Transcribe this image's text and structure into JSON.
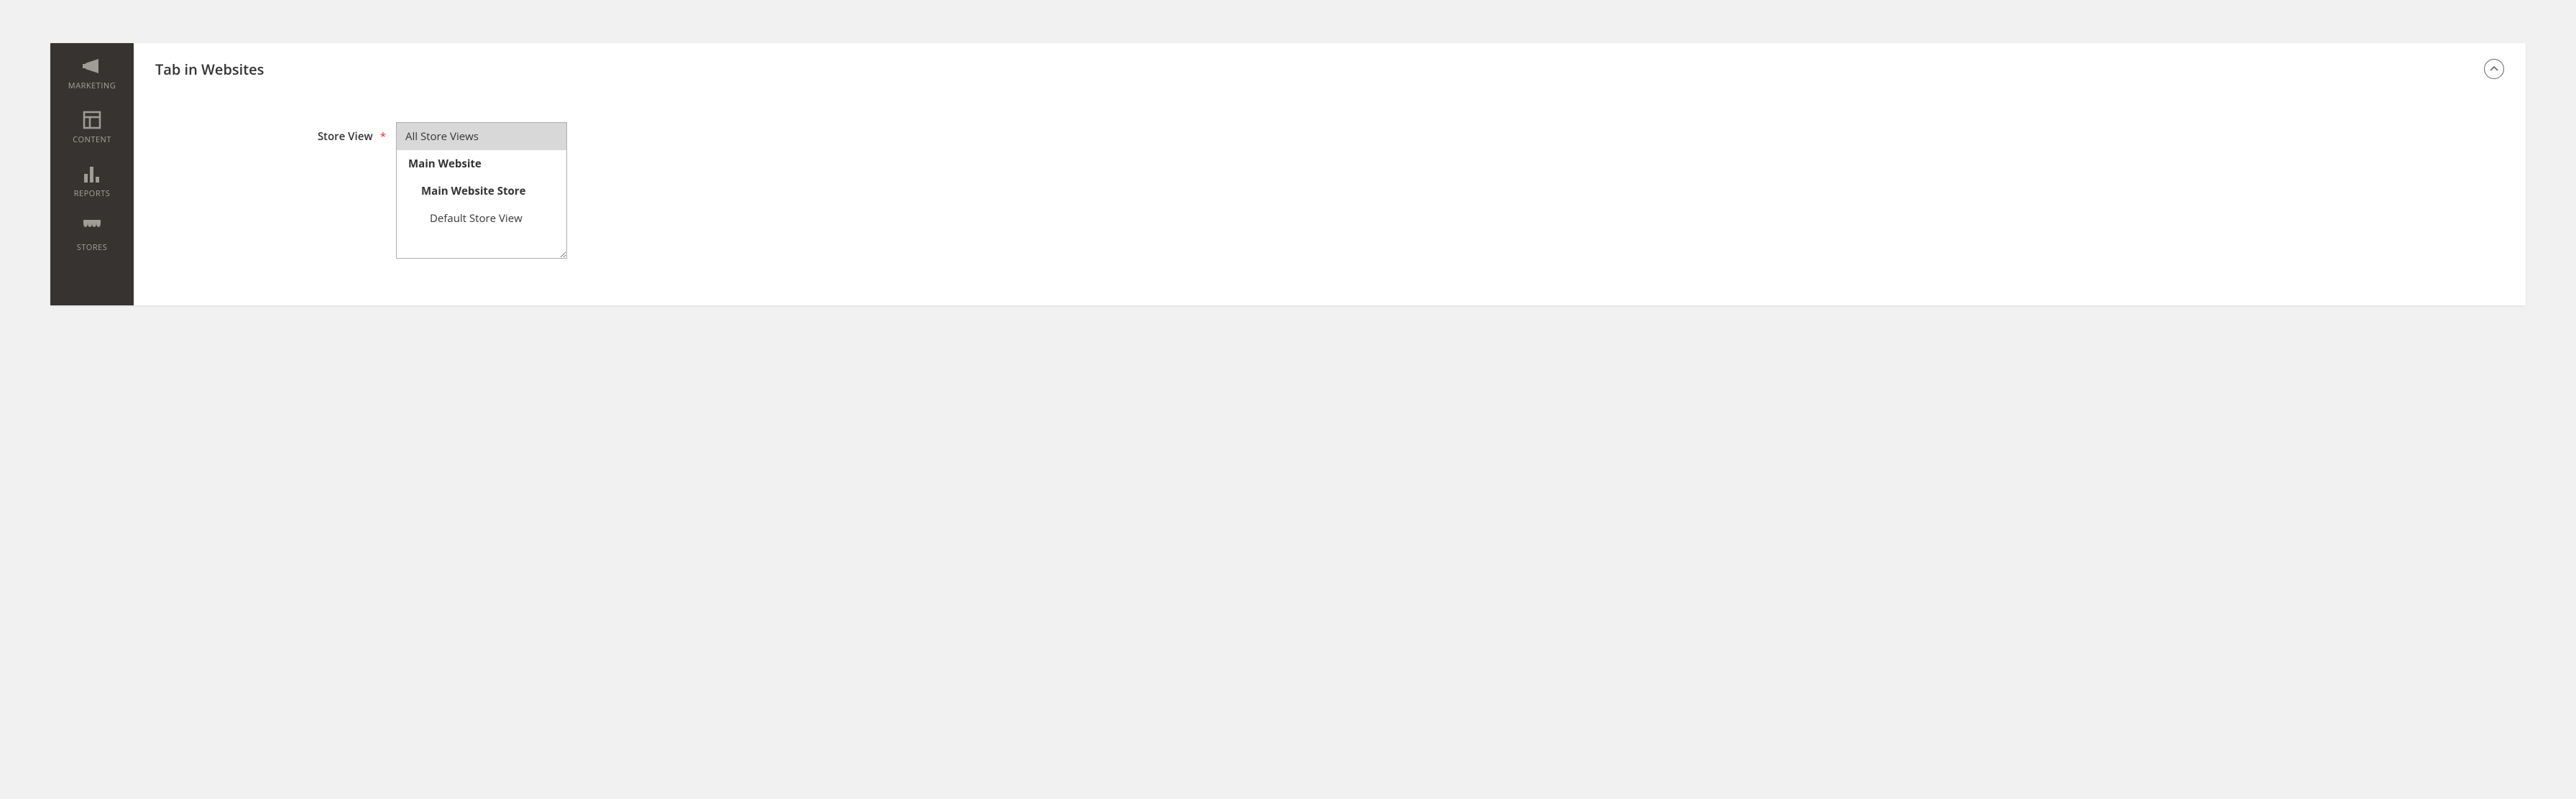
{
  "sidebar": {
    "items": [
      {
        "label": "MARKETING",
        "icon": "megaphone-icon"
      },
      {
        "label": "CONTENT",
        "icon": "layout-icon"
      },
      {
        "label": "REPORTS",
        "icon": "bar-chart-icon"
      },
      {
        "label": "STORES",
        "icon": "storefront-icon"
      }
    ]
  },
  "section": {
    "title": "Tab in Websites"
  },
  "form": {
    "store_view_label": "Store View",
    "required_mark": "*",
    "options": [
      {
        "label": "All Store Views",
        "level": 0,
        "selected": true
      },
      {
        "label": "Main Website",
        "level": 1,
        "selected": false
      },
      {
        "label": "Main Website Store",
        "level": 2,
        "selected": false
      },
      {
        "label": "Default Store View",
        "level": 3,
        "selected": false
      }
    ]
  }
}
